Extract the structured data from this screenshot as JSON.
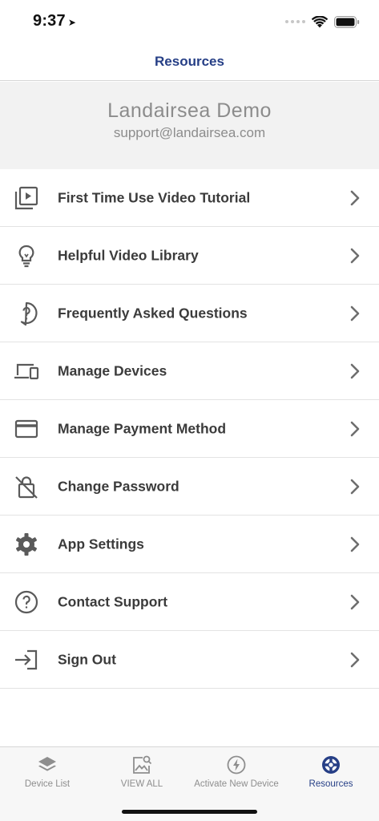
{
  "status": {
    "time": "9:37",
    "location_glyph": "➤"
  },
  "nav": {
    "title": "Resources"
  },
  "profile": {
    "name": "Landairsea Demo",
    "email": "support@landairsea.com"
  },
  "menu": [
    {
      "label": "First Time Use Video Tutorial",
      "icon": "video-tutorial-icon"
    },
    {
      "label": "Helpful Video Library",
      "icon": "lightbulb-icon"
    },
    {
      "label": "Frequently Asked Questions",
      "icon": "question-bubble-icon"
    },
    {
      "label": "Manage Devices",
      "icon": "devices-icon"
    },
    {
      "label": "Manage Payment Method",
      "icon": "credit-card-icon"
    },
    {
      "label": "Change Password",
      "icon": "lock-off-icon"
    },
    {
      "label": "App Settings",
      "icon": "gear-icon"
    },
    {
      "label": "Contact Support",
      "icon": "help-circle-icon"
    },
    {
      "label": "Sign Out",
      "icon": "sign-out-icon"
    }
  ],
  "tabs": [
    {
      "label": "Device List",
      "icon": "layers-icon"
    },
    {
      "label": "VIEW ALL",
      "icon": "image-search-icon"
    },
    {
      "label": "Activate New Device",
      "icon": "lightning-circle-icon"
    },
    {
      "label": "Resources",
      "icon": "lifebuoy-icon",
      "active": true
    }
  ],
  "colors": {
    "accent": "#263f86",
    "icon_gray": "#5a5a5a",
    "chevron": "#6e6e6e"
  }
}
